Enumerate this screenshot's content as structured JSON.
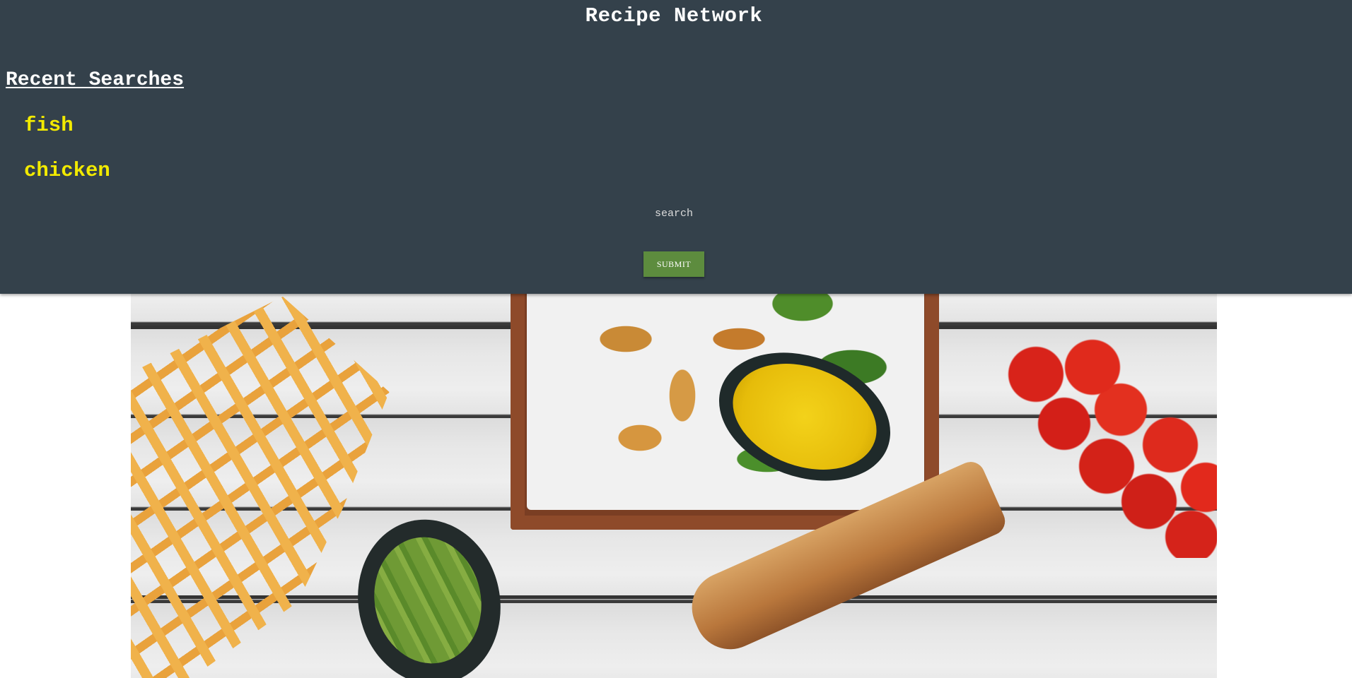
{
  "header": {
    "title": "Recipe Network",
    "recent_heading": "Recent Searches",
    "recent_items": [
      "fish",
      "chicken"
    ],
    "search": {
      "value": "",
      "placeholder": "search"
    },
    "submit_label": "SUBMIT"
  },
  "hero": {
    "image_label": "food-photo"
  },
  "colors": {
    "header_bg": "#34414b",
    "recent_item": "#f2ea00",
    "submit_bg": "#5d8c3e"
  }
}
